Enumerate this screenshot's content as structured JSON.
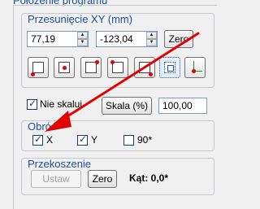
{
  "window": {
    "top_title": "Położenie programu"
  },
  "shift": {
    "title": "Przesunięcie XY (mm)",
    "x_value": "77,19",
    "y_value": "-123,04",
    "zero_label": "Zero"
  },
  "align_icons": [
    "align-top-left-icon",
    "align-center-icon",
    "align-top-right-icon",
    "align-bottom-left-icon",
    "align-bottom-right-icon",
    "align-center-frame-icon",
    "align-origin-icon"
  ],
  "scale": {
    "no_scale_label": "Nie skaluj",
    "no_scale_checked": true,
    "scale_button_label": "Skala (%)",
    "scale_value": "100,00"
  },
  "rotate": {
    "title": "Obróć",
    "x_label": "X",
    "x_checked": true,
    "y_label": "Y",
    "y_checked": true,
    "deg90_label": "90*",
    "deg90_checked": false
  },
  "skew": {
    "title": "Przekoszenie",
    "apply_label": "Ustaw",
    "zero_label": "Zero",
    "angle_text": "Kąt: 0,0*"
  },
  "colors": {
    "accent_title": "#1f4e9b",
    "annotation_arrow": "#e40000"
  }
}
